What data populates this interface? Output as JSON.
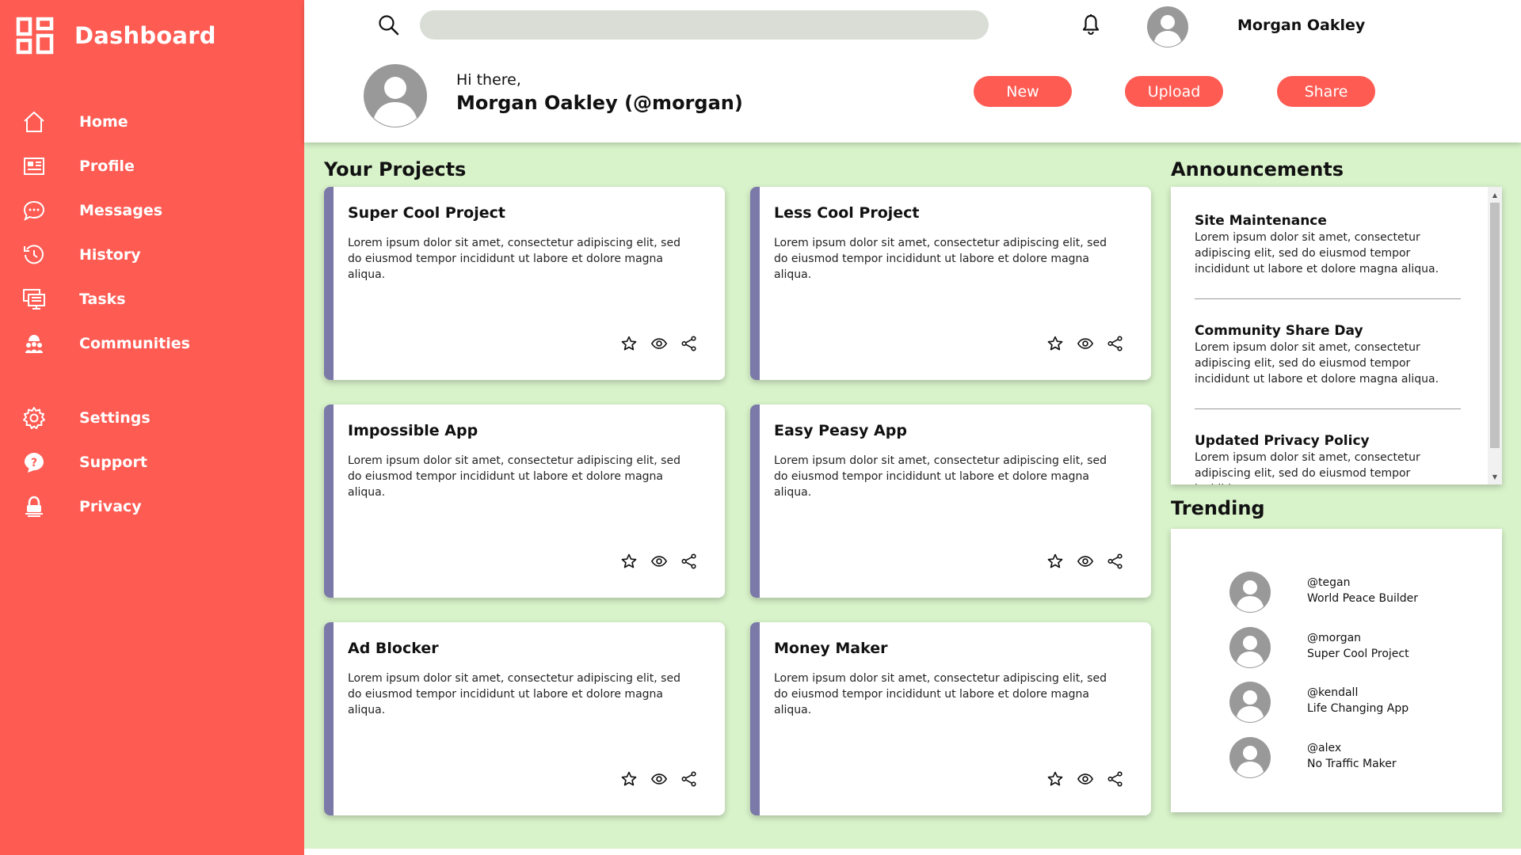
{
  "app": {
    "title": "Dashboard"
  },
  "sidebar": {
    "items": [
      {
        "label": "Home",
        "icon": "home-icon"
      },
      {
        "label": "Profile",
        "icon": "profile-card-icon"
      },
      {
        "label": "Messages",
        "icon": "chat-bubble-icon"
      },
      {
        "label": "History",
        "icon": "history-icon"
      },
      {
        "label": "Tasks",
        "icon": "tasks-monitor-icon"
      },
      {
        "label": "Communities",
        "icon": "communities-icon"
      }
    ],
    "secondary": [
      {
        "label": "Settings",
        "icon": "gear-icon"
      },
      {
        "label": "Support",
        "icon": "help-icon"
      },
      {
        "label": "Privacy",
        "icon": "privacy-icon"
      }
    ]
  },
  "header": {
    "search": {
      "placeholder": "",
      "value": ""
    },
    "username": "Morgan Oakley",
    "greeting": "Hi there,",
    "display_name": "Morgan Oakley (@morgan)",
    "buttons": {
      "new": "New",
      "upload": "Upload",
      "share": "Share"
    }
  },
  "projects": {
    "title": "Your Projects",
    "items": [
      {
        "title": "Super Cool Project",
        "body": "Lorem ipsum dolor sit amet, consectetur adipiscing elit, sed do eiusmod tempor incididunt ut labore et dolore magna aliqua."
      },
      {
        "title": "Less Cool Project",
        "body": "Lorem ipsum dolor sit amet, consectetur adipiscing elit, sed do eiusmod tempor incididunt ut labore et dolore magna aliqua."
      },
      {
        "title": "Impossible App",
        "body": "Lorem ipsum dolor sit amet, consectetur adipiscing elit, sed do eiusmod tempor incididunt ut labore et dolore magna aliqua."
      },
      {
        "title": "Easy Peasy App",
        "body": "Lorem ipsum dolor sit amet, consectetur adipiscing elit, sed do eiusmod tempor incididunt ut labore et dolore magna aliqua."
      },
      {
        "title": "Ad Blocker",
        "body": "Lorem ipsum dolor sit amet, consectetur adipiscing elit, sed do eiusmod tempor incididunt ut labore et dolore magna aliqua."
      },
      {
        "title": "Money Maker",
        "body": "Lorem ipsum dolor sit amet, consectetur adipiscing elit, sed do eiusmod tempor incididunt ut labore et dolore magna aliqua."
      }
    ]
  },
  "announcements": {
    "title": "Announcements",
    "items": [
      {
        "title": "Site Maintenance",
        "body": "Lorem ipsum dolor sit amet, consectetur adipiscing elit, sed do eiusmod tempor incididunt ut labore et dolore magna aliqua."
      },
      {
        "title": "Community Share Day",
        "body": "Lorem ipsum dolor sit amet, consectetur adipiscing elit, sed do eiusmod tempor incididunt ut labore et dolore magna aliqua."
      },
      {
        "title": "Updated Privacy Policy",
        "body": "Lorem ipsum dolor sit amet, consectetur adipiscing elit, sed do eiusmod tempor incididunt"
      }
    ]
  },
  "trending": {
    "title": "Trending",
    "items": [
      {
        "handle": "@tegan",
        "project": "World Peace Builder"
      },
      {
        "handle": "@morgan",
        "project": "Super Cool Project"
      },
      {
        "handle": "@kendall",
        "project": "Life Changing App"
      },
      {
        "handle": "@alex",
        "project": "No Traffic Maker"
      }
    ]
  },
  "colors": {
    "accent": "#fe5b53",
    "main_bg": "#d8f2ca",
    "card_stripe": "#7b79a8",
    "search_bg": "#d9ddd6",
    "avatar": "#999999"
  }
}
